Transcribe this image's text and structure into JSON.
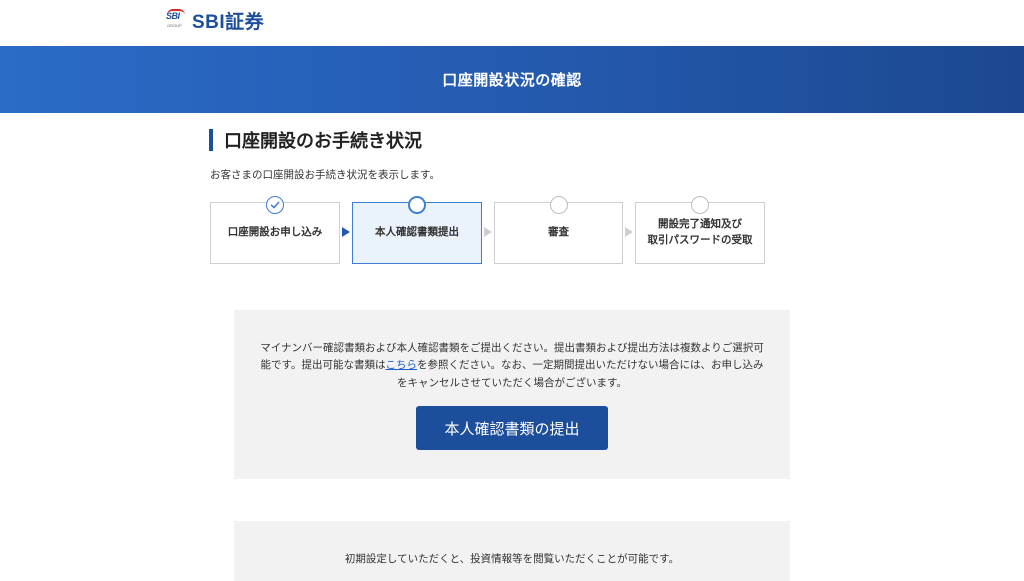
{
  "brand": {
    "logo_mark": "SBI",
    "logo_group": "GROUP",
    "logo_text": "SBI証券"
  },
  "hero": {
    "title": "口座開設状況の確認"
  },
  "section": {
    "title": "口座開設のお手続き状況",
    "intro": "お客さまの口座開設お手続き状況を表示します。"
  },
  "steps": [
    {
      "label": "口座開設お申し込み",
      "state": "done"
    },
    {
      "label": "本人確認書類提出",
      "state": "current"
    },
    {
      "label": "審査",
      "state": "pending"
    },
    {
      "label_line1": "開設完了通知及び",
      "label_line2": "取引パスワードの受取",
      "state": "pending"
    }
  ],
  "notice": {
    "before_link": "マイナンバー確認書類および本人確認書類をご提出ください。提出書類および提出方法は複数よりご選択可能です。提出可能な書類は",
    "link": "こちら",
    "after_link": "を参照ください。なお、一定期間提出いただけない場合には、お申し込みをキャンセルさせていただく場合がございます。"
  },
  "primary_button": "本人確認書類の提出",
  "second_panel_text": "初期設定していただくと、投資情報等を閲覧いただくことが可能です。",
  "colors": {
    "brand_blue": "#1d4e9c",
    "accent_blue": "#3f7ed6",
    "panel_bg": "#f2f2f2"
  },
  "icons": {
    "done": "check-icon"
  }
}
